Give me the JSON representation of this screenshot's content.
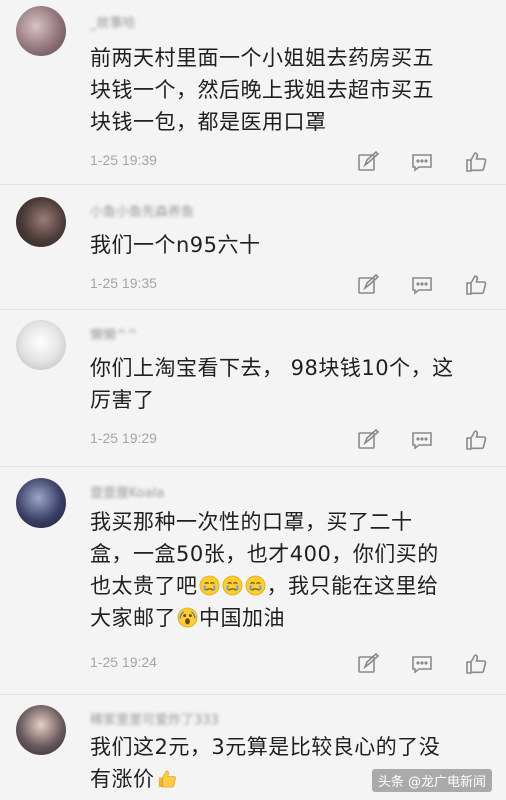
{
  "comments": [
    {
      "username": "_故事哈",
      "lines": [
        "前两天村里面一个小姐姐去药房买五",
        "块钱一个，然后晚上我姐去超市买五",
        "块钱一包，都是医用口罩"
      ],
      "timestamp": "1-25 19:39"
    },
    {
      "username": "小鱼小鱼先森养鱼",
      "lines": [
        "我们一个n95六十"
      ],
      "timestamp": "1-25 19:35"
    },
    {
      "username": "懒懒^^",
      "lines": [
        "你们上淘宝看下去， 98块钱10个，这",
        "厉害了"
      ],
      "timestamp": "1-25 19:29"
    },
    {
      "username": "壹壹厘Koala",
      "lines": [
        "我买那种一次性的口罩，买了二十",
        "盒，一盒50张，也才400，你们买的",
        "也太贵了吧",
        "，我只能在这里给",
        "大家邮了",
        "中国加油"
      ],
      "timestamp": "1-25 19:24"
    },
    {
      "username": "稀家里里可爱炸了333",
      "lines": [
        "我们这2元，3元算是比较良心的了没",
        "有涨价"
      ],
      "timestamp": ""
    }
  ],
  "watermark": "头条 @龙广电新闻",
  "icons": [
    "edit-icon",
    "comment-icon",
    "thumbs-up-icon",
    "crying-emoji-icon",
    "screaming-emoji-icon",
    "thumbs-up-emoji-icon"
  ]
}
